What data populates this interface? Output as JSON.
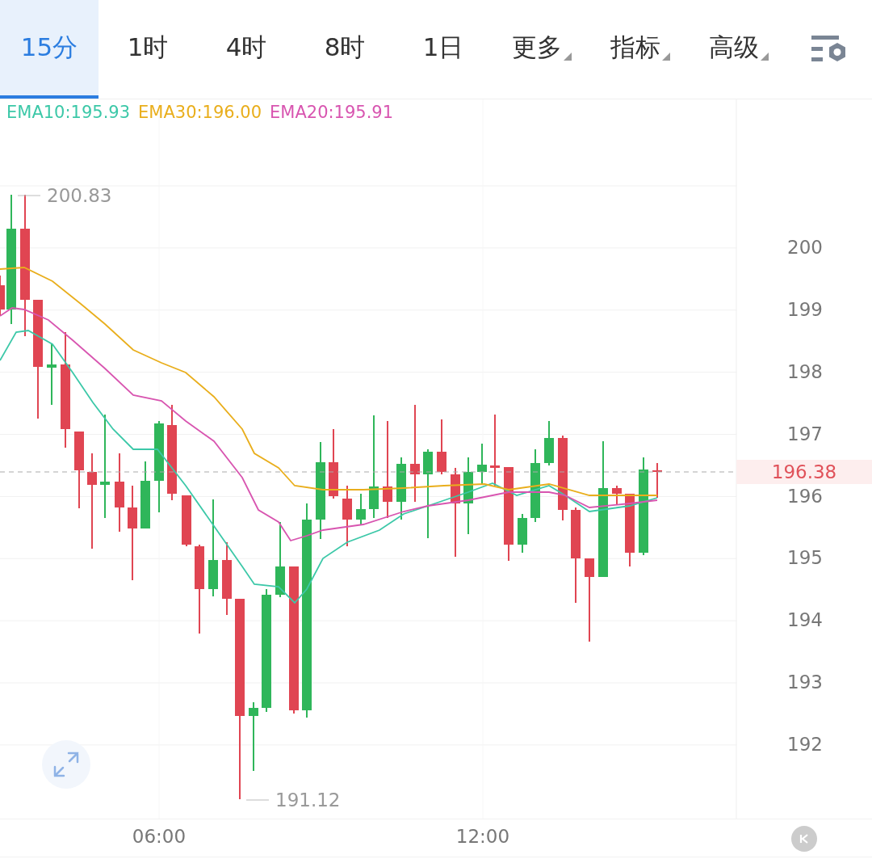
{
  "tabs": [
    {
      "label": "15分",
      "selected": true,
      "kind": "plain"
    },
    {
      "label": "1时",
      "selected": false,
      "kind": "plain"
    },
    {
      "label": "4时",
      "selected": false,
      "kind": "plain"
    },
    {
      "label": "8时",
      "selected": false,
      "kind": "plain"
    },
    {
      "label": "1日",
      "selected": false,
      "kind": "plain"
    },
    {
      "label": "更多",
      "selected": false,
      "kind": "menu"
    },
    {
      "label": "指标",
      "selected": false,
      "kind": "menu"
    },
    {
      "label": "高级",
      "selected": false,
      "kind": "menu"
    }
  ],
  "legend": [
    {
      "label": "EMA10:195.93",
      "color": "#3cc8a8"
    },
    {
      "label": "EMA30:196.00",
      "color": "#e9ae1c"
    },
    {
      "label": "EMA20:195.91",
      "color": "#d855b0"
    }
  ],
  "chart": {
    "y_axis_labels": [
      "200",
      "199",
      "198",
      "197",
      "196",
      "195",
      "194",
      "193",
      "192"
    ],
    "max_label": "200.83",
    "min_label": "191.12",
    "last_price": "196.38",
    "x_axis_labels": [
      "06:00",
      "12:00"
    ]
  }
}
